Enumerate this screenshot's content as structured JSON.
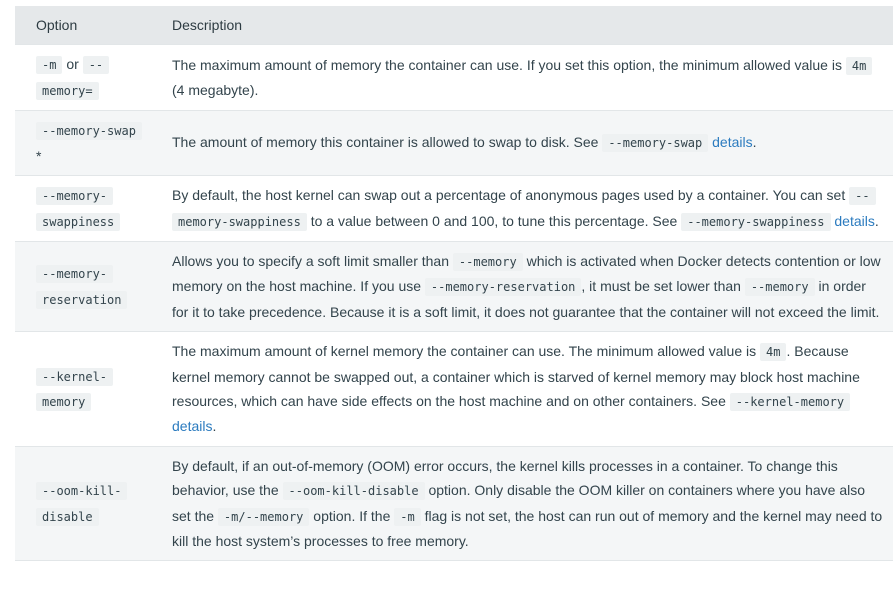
{
  "header": {
    "option": "Option",
    "description": "Description"
  },
  "rows": {
    "m": {
      "opt_code1": "-m",
      "opt_or": " or ",
      "opt_code2": "--memory=",
      "d1": "The maximum amount of memory the container can use. If you set this option, the minimum allowed value is ",
      "c1": "4m",
      "d2": " (4 megabyte)."
    },
    "swap": {
      "opt_code": "--memory-swap",
      "opt_star": " *",
      "d1": "The amount of memory this container is allowed to swap to disk. See ",
      "c1": "--memory-swap",
      "d2": " ",
      "link": "details",
      "d3": "."
    },
    "swappiness": {
      "opt_code": "--memory-swappiness",
      "d1": "By default, the host kernel can swap out a percentage of anonymous pages used by a container. You can set ",
      "c1": "--memory-swappiness",
      "d2": " to a value between 0 and 100, to tune this percentage. See ",
      "c2": "--memory-swappiness",
      "d3": " ",
      "link": "details",
      "d4": "."
    },
    "reservation": {
      "opt_code": "--memory-reservation",
      "d1": "Allows you to specify a soft limit smaller than ",
      "c1": "--memory",
      "d2": " which is activated when Docker detects contention or low memory on the host machine. If you use ",
      "c2": "--memory-reservation",
      "d3": ", it must be set lower than ",
      "c3": "--memory",
      "d4": " in order for it to take precedence. Because it is a soft limit, it does not guarantee that the container will not exceed the limit."
    },
    "kernel": {
      "opt_code": "--kernel-memory",
      "d1": "The maximum amount of kernel memory the container can use. The minimum allowed value is ",
      "c1": "4m",
      "d2": ". Because kernel memory cannot be swapped out, a container which is starved of kernel memory may block host machine resources, which can have side effects on the host machine and on other containers. See ",
      "c2": "--kernel-memory",
      "d3": " ",
      "link": "details",
      "d4": "."
    },
    "oom": {
      "opt_code": "--oom-kill-disable",
      "d1": "By default, if an out-of-memory (OOM) error occurs, the kernel kills processes in a container. To change this behavior, use the ",
      "c1": "--oom-kill-disable",
      "d2": " option. Only disable the OOM killer on containers where you have also set the ",
      "c2": "-m/--memory",
      "d3": " option. If the ",
      "c3": "-m",
      "d4": " flag is not set, the host can run out of memory and the kernel may need to kill the host system’s processes to free memory."
    }
  }
}
